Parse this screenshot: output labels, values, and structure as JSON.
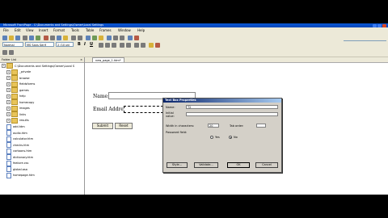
{
  "window": {
    "title": "Microsoft FrontPage - C:\\Documents and Settings\\Owner\\Local Settings"
  },
  "menu": [
    "File",
    "Edit",
    "View",
    "Insert",
    "Format",
    "Tools",
    "Table",
    "Frames",
    "Window",
    "Help"
  ],
  "toolbar": {
    "style": "Normal",
    "font": "MS Sans Serif",
    "size": "2 (10 pt)",
    "bold": "B",
    "italic": "I",
    "underline": "U"
  },
  "help_box": {
    "placeholder": "Type a question for help"
  },
  "folder_list": {
    "title": "Folder List",
    "close": "×",
    "items": [
      {
        "label": "C:\\Documents and Settings\\Owner\\Local S",
        "type": "folder",
        "level": 0
      },
      {
        "label": "_private",
        "type": "folder",
        "level": 1
      },
      {
        "label": "browse",
        "type": "folder",
        "level": 1
      },
      {
        "label": "fieldsforms",
        "type": "folder",
        "level": 1
      },
      {
        "label": "games",
        "type": "folder",
        "level": 1
      },
      {
        "label": "help",
        "type": "folder",
        "level": 1
      },
      {
        "label": "homecopy",
        "type": "folder",
        "level": 1
      },
      {
        "label": "images",
        "type": "folder",
        "level": 1
      },
      {
        "label": "links",
        "type": "folder",
        "level": 1
      },
      {
        "label": "results",
        "type": "folder",
        "level": 1
      },
      {
        "label": "add.htm",
        "type": "file",
        "level": 1
      },
      {
        "label": "audio.htm",
        "type": "file",
        "level": 1
      },
      {
        "label": "calculator.htm",
        "type": "file",
        "level": 1
      },
      {
        "label": "checks.htm",
        "type": "file",
        "level": 1
      },
      {
        "label": "cartoons.htm",
        "type": "file",
        "level": 1
      },
      {
        "label": "dictionary.htm",
        "type": "file",
        "level": 1
      },
      {
        "label": "feature.css",
        "type": "file",
        "level": 1
      },
      {
        "label": "global.asa",
        "type": "file",
        "level": 1
      },
      {
        "label": "homepage.htm",
        "type": "file",
        "level": 1
      }
    ]
  },
  "editor": {
    "tab": "new_page_1.htm*",
    "form": {
      "name_label": "Name:",
      "email_label": "Email Address:",
      "submit": "Submit",
      "reset": "Reset"
    }
  },
  "dialog": {
    "title": "Text Box Properties",
    "name_label": "Name:",
    "name_value": "T2",
    "initial_label": "Initial value:",
    "width_label": "Width in characters:",
    "width_value": "20",
    "tab_order_label": "Tab order:",
    "password_label": "Password field:",
    "yes": "Yes",
    "no": "No",
    "style_btn": "Style...",
    "validate_btn": "Validate...",
    "ok_btn": "OK",
    "cancel_btn": "Cancel"
  },
  "colors": {
    "titlebar": "#0a58d6",
    "dialog_title": "#0a246a",
    "chrome": "#ece9d8"
  }
}
